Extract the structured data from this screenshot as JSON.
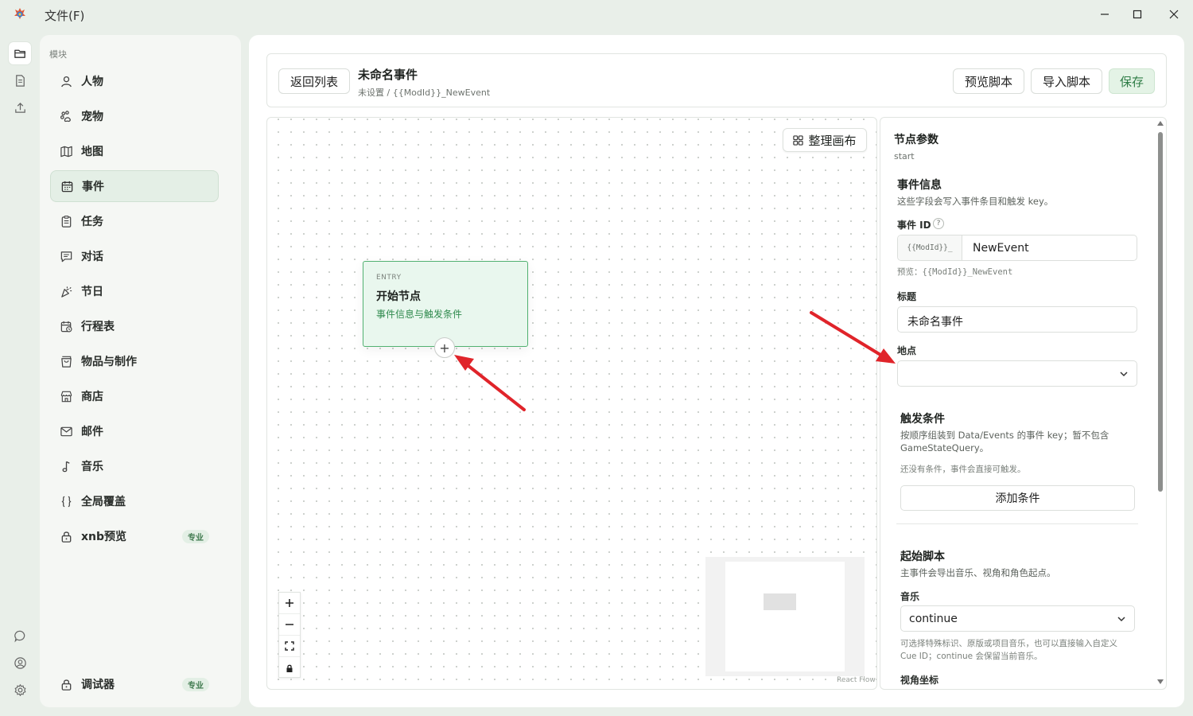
{
  "titlebar": {
    "menu_file": "文件(F)",
    "icons": [
      "app-logo",
      "minimize-icon",
      "maximize-icon",
      "close-icon"
    ]
  },
  "rail": {
    "top_icons": [
      "folder-icon",
      "document-icon",
      "upload-icon"
    ],
    "bottom_icons": [
      "chat-icon",
      "user-icon",
      "settings-icon"
    ]
  },
  "sidebar": {
    "header": "模块",
    "items": [
      {
        "label": "人物",
        "icon": "person-icon"
      },
      {
        "label": "宠物",
        "icon": "pet-icon"
      },
      {
        "label": "地图",
        "icon": "map-icon"
      },
      {
        "label": "事件",
        "icon": "calendar-icon",
        "active": true
      },
      {
        "label": "任务",
        "icon": "clipboard-icon"
      },
      {
        "label": "对话",
        "icon": "dialog-icon"
      },
      {
        "label": "节日",
        "icon": "party-icon"
      },
      {
        "label": "行程表",
        "icon": "schedule-icon"
      },
      {
        "label": "物品与制作",
        "icon": "bag-icon"
      },
      {
        "label": "商店",
        "icon": "shop-icon"
      },
      {
        "label": "邮件",
        "icon": "mail-icon"
      },
      {
        "label": "音乐",
        "icon": "music-icon"
      },
      {
        "label": "全局覆盖",
        "icon": "braces-icon"
      },
      {
        "label": "xnb预览",
        "icon": "lock-icon",
        "badge": "专业"
      }
    ],
    "footer_item": {
      "label": "调试器",
      "icon": "lock-icon",
      "badge": "专业"
    }
  },
  "header": {
    "back_label": "返回列表",
    "title": "未命名事件",
    "subtitle": "未设置 / {{ModId}}_NewEvent",
    "preview_label": "预览脚本",
    "import_label": "导入脚本",
    "save_label": "保存"
  },
  "canvas": {
    "arrange_label": "整理画布",
    "node": {
      "tag": "ENTRY",
      "title": "开始节点",
      "subtitle": "事件信息与触发条件",
      "add_symbol": "+"
    },
    "zoom_controls": [
      "zoom-in-icon",
      "zoom-out-icon",
      "fit-view-icon",
      "lock-icon"
    ],
    "attribution": "React Flow"
  },
  "panel": {
    "title": "节点参数",
    "subtitle": "start",
    "event_info": {
      "title": "事件信息",
      "desc": "这些字段会写入事件条目和触发 key。",
      "id_label": "事件 ID",
      "help_symbol": "?",
      "id_prefix": "{{ModId}}_",
      "id_value": "NewEvent",
      "preview_prefix": "预览：",
      "preview_value": "{{ModId}}_NewEvent",
      "title_label": "标题",
      "title_value": "未命名事件",
      "location_label": "地点",
      "location_value": ""
    },
    "trigger": {
      "title": "触发条件",
      "desc_line1": "按顺序组装到 Data/Events 的事件 key；暂不包含",
      "desc_line2": "GameStateQuery。",
      "empty_hint": "还没有条件，事件会直接可触发。",
      "add_label": "添加条件"
    },
    "script": {
      "title": "起始脚本",
      "desc": "主事件会导出音乐、视角和角色起点。",
      "music_label": "音乐",
      "music_value": "continue",
      "music_help_line1": "可选择特殊标识、原版或项目音乐，也可以直接输入自定义",
      "music_help_line2": "Cue ID；continue 会保留当前音乐。",
      "camera_label": "视角坐标"
    }
  },
  "colors": {
    "accent_green": "#2f8a4d",
    "node_border": "#52b171",
    "annotation_red": "#e0242a"
  }
}
